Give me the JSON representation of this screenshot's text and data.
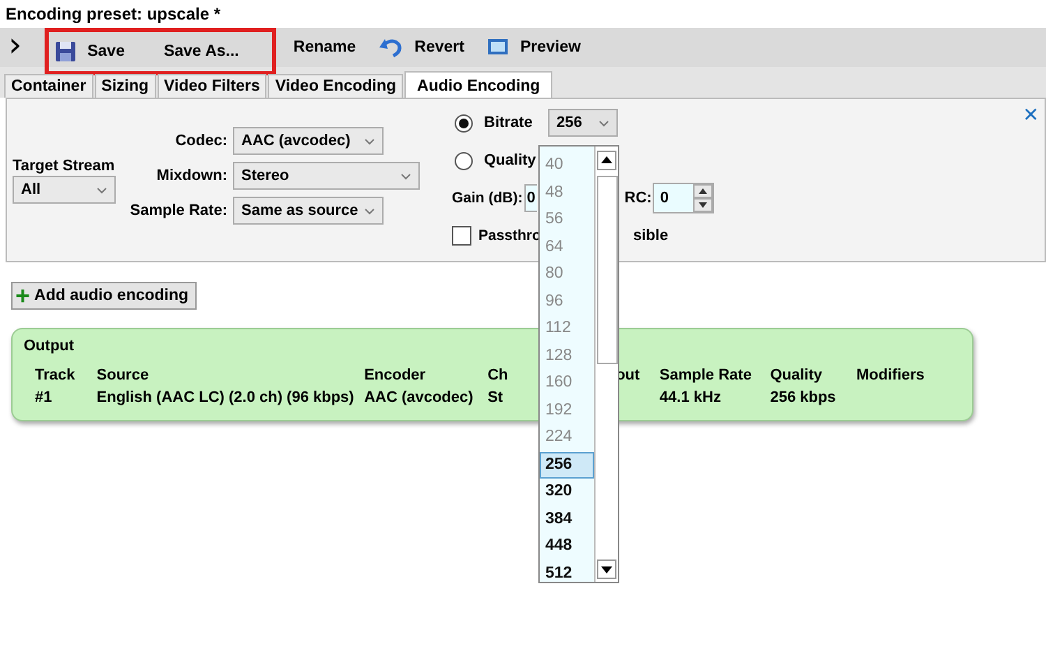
{
  "window": {
    "title": "Encoding preset: upscale *"
  },
  "toolbar": {
    "expander": "›",
    "buttons": [
      {
        "label": "Save",
        "kind": "save",
        "highlighted": true
      },
      {
        "label": "Save As...",
        "kind": "plain",
        "highlighted": true
      },
      {
        "label": "Rename",
        "kind": "plain",
        "highlighted": false
      },
      {
        "label": "Revert",
        "kind": "revert",
        "highlighted": false
      },
      {
        "label": "Preview",
        "kind": "preview",
        "highlighted": false
      }
    ]
  },
  "tabs": [
    {
      "label": "Container",
      "selected": false
    },
    {
      "label": "Sizing",
      "selected": false
    },
    {
      "label": "Video Filters",
      "selected": false
    },
    {
      "label": "Video Encoding",
      "selected": false
    },
    {
      "label": "Audio Encoding",
      "selected": true
    }
  ],
  "audio_panel": {
    "target_stream": {
      "label": "Target Stream",
      "value": "All"
    },
    "fields": [
      {
        "label": "Codec:",
        "value": "AAC (avcodec)",
        "wide": false
      },
      {
        "label": "Mixdown:",
        "value": "Stereo",
        "wide": true
      },
      {
        "label": "Sample Rate:",
        "value": "Same as source",
        "wide": false
      }
    ],
    "bitrate": {
      "label": "Bitrate",
      "selected": true,
      "value": "256"
    },
    "quality": {
      "label": "Quality",
      "selected": false
    },
    "gain": {
      "label": "Gain (dB):",
      "value": "0"
    },
    "drc": {
      "label": "RC:",
      "value": "0"
    },
    "passthrough": {
      "label_start": "Passthro",
      "label_end": "sible",
      "checked": false
    },
    "close": "✕"
  },
  "add_button": {
    "icon": "+",
    "label": "Add audio encoding"
  },
  "output": {
    "title": "Output",
    "columns": [
      "Track",
      "Source",
      "Encoder",
      "Ch",
      "out",
      "Sample Rate",
      "Quality",
      "Modifiers"
    ],
    "rows": [
      {
        "track": "#1",
        "source": "English (AAC LC) (2.0 ch) (96 kbps)",
        "encoder": "AAC (avcodec)",
        "ch": "St",
        "sample_rate": "44.1 kHz",
        "quality": "256 kbps"
      }
    ]
  },
  "bitrate_dropdown": {
    "options": [
      {
        "label": "40",
        "disabled": true,
        "selected": false
      },
      {
        "label": "48",
        "disabled": true,
        "selected": false
      },
      {
        "label": "56",
        "disabled": true,
        "selected": false
      },
      {
        "label": "64",
        "disabled": true,
        "selected": false
      },
      {
        "label": "80",
        "disabled": true,
        "selected": false
      },
      {
        "label": "96",
        "disabled": true,
        "selected": false
      },
      {
        "label": "112",
        "disabled": true,
        "selected": false
      },
      {
        "label": "128",
        "disabled": true,
        "selected": false
      },
      {
        "label": "160",
        "disabled": true,
        "selected": false
      },
      {
        "label": "192",
        "disabled": true,
        "selected": false
      },
      {
        "label": "224",
        "disabled": true,
        "selected": false
      },
      {
        "label": "256",
        "disabled": false,
        "selected": true
      },
      {
        "label": "320",
        "disabled": false,
        "selected": false
      },
      {
        "label": "384",
        "disabled": false,
        "selected": false
      },
      {
        "label": "448",
        "disabled": false,
        "selected": false
      },
      {
        "label": "512",
        "disabled": false,
        "selected": false
      }
    ]
  }
}
